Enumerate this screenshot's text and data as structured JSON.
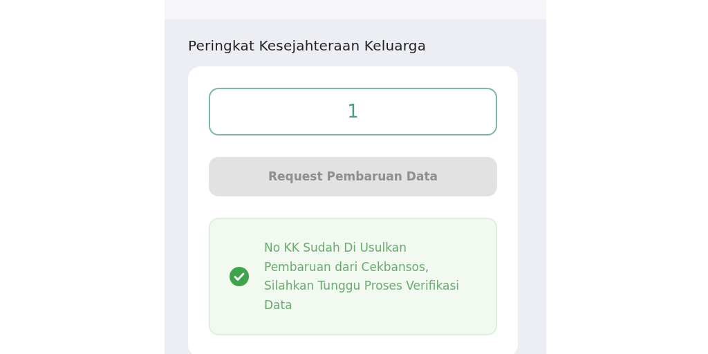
{
  "section": {
    "title": "Peringkat Kesejahteraan Keluarga"
  },
  "rank_field": {
    "value": "1"
  },
  "request_button": {
    "label": "Request Pembaruan Data",
    "disabled": true
  },
  "notice": {
    "kind": "success",
    "text": "No KK Sudah Di Usulkan Pembaruan dari Cekbansos, Silahkan Tunggu Proses Verifikasi Data"
  }
}
